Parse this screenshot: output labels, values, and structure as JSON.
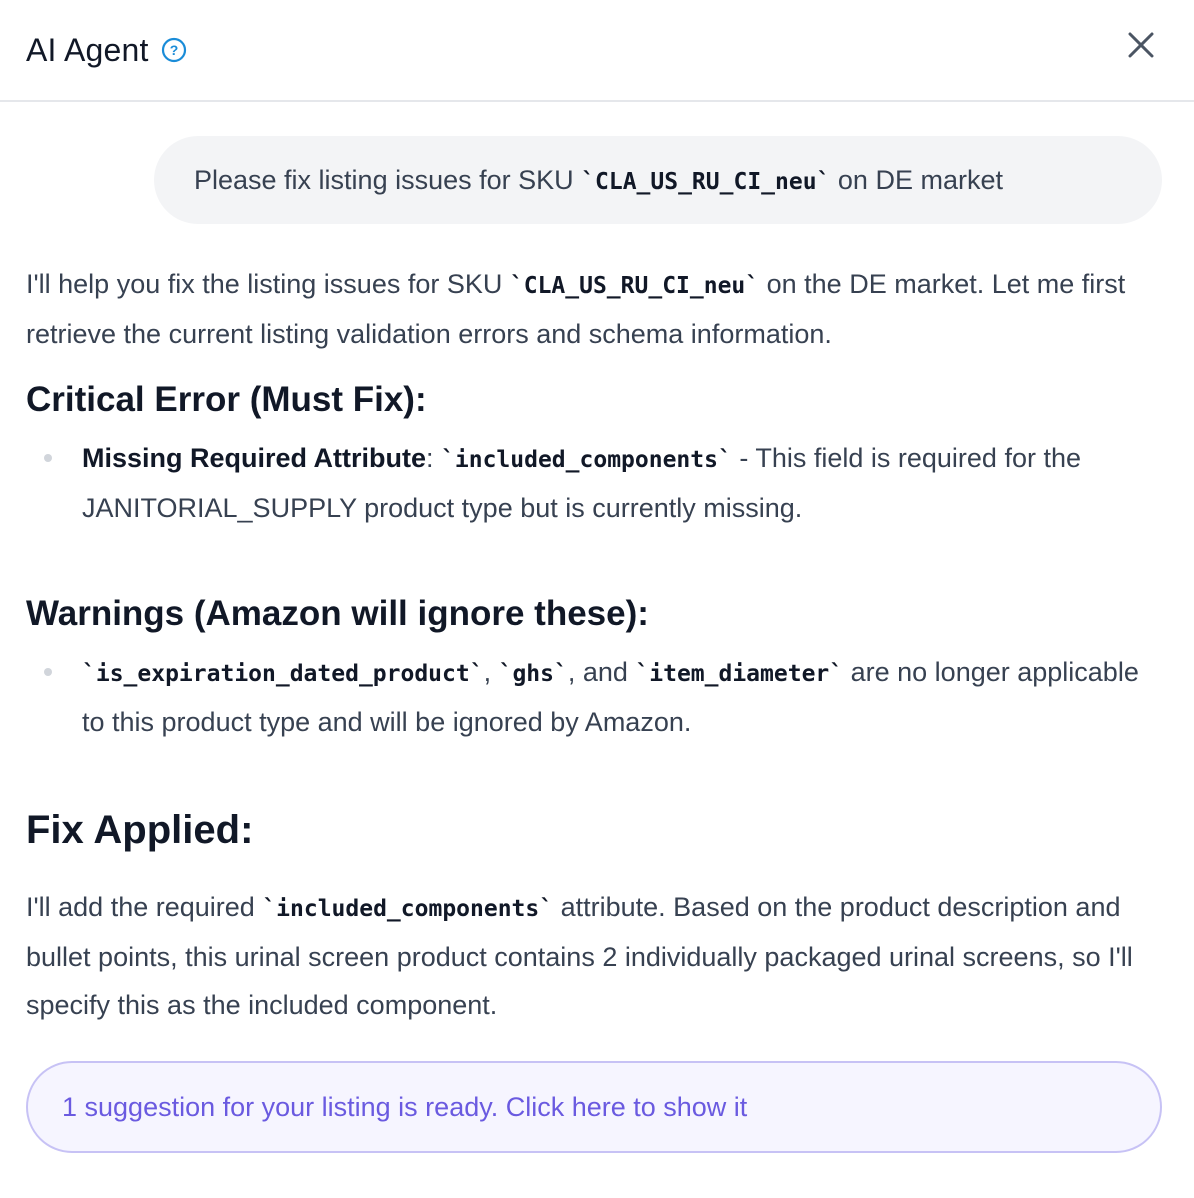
{
  "header": {
    "title": "AI Agent",
    "help_icon": "question-circle-icon",
    "close_icon": "close-icon"
  },
  "chat": {
    "user_message": {
      "prefix": "Please fix listing issues for SKU ",
      "sku": "`CLA_US_RU_CI_neu`",
      "suffix": " on DE market"
    },
    "intro": {
      "prefix": "I'll help you fix the listing issues for SKU ",
      "sku": "`CLA_US_RU_CI_neu`",
      "suffix": " on the DE market. Let me first retrieve the current listing validation errors and schema information."
    },
    "critical": {
      "heading": "Critical Error (Must Fix):",
      "item": {
        "label": "Missing Required Attribute",
        "colon": ": ",
        "code": "`included_components`",
        "text": " - This field is required for the JANITORIAL_SUPPLY product type but is currently missing."
      }
    },
    "warnings": {
      "heading": "Warnings (Amazon will ignore these):",
      "item": {
        "code1": "`is_expiration_dated_product`",
        "sep1": ", ",
        "code2": "`ghs`",
        "sep2": ", and ",
        "code3": "`item_diameter`",
        "text": " are no longer applicable to this product type and will be ignored by Amazon."
      }
    },
    "fix": {
      "heading": "Fix Applied:",
      "prefix": "I'll add the required ",
      "code": "`included_components`",
      "suffix": " attribute. Based on the product description and bullet points, this urinal screen product contains 2 individually packaged urinal screens, so I'll specify this as the included component."
    },
    "suggestion": {
      "label": "1 suggestion for your listing is ready. Click here to show it"
    }
  },
  "colors": {
    "accent": "#6a5ae0",
    "help_icon": "#1a8cd8",
    "bubble_bg": "#f3f4f6"
  }
}
